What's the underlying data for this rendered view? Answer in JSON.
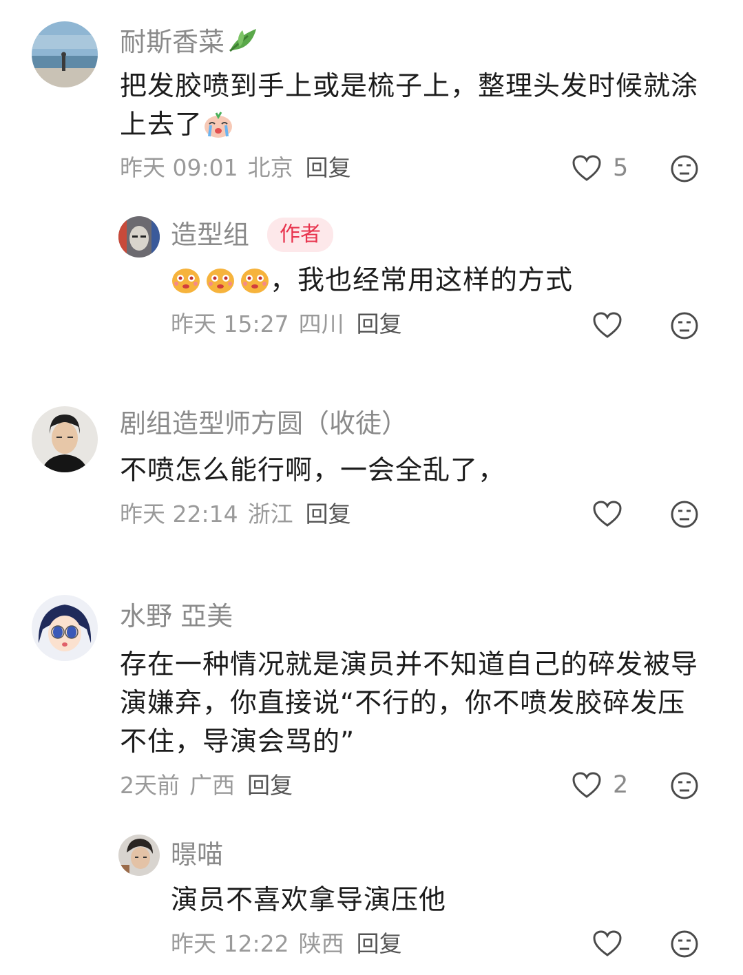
{
  "comments": [
    {
      "username": "耐斯香菜",
      "username_icon": "leaf-icon",
      "text": "把发胶喷到手上或是梳子上，整理头发时候就涂上去了",
      "trailing_emoji": "crying-emoji",
      "time": "昨天 09:01",
      "location": "北京",
      "reply_label": "回复",
      "likes": "5"
    },
    {
      "username": "造型组",
      "badge": "作者",
      "leading_emoji": "blushing-emoji",
      "text": "，我也经常用这样的方式",
      "time": "昨天 15:27",
      "location": "四川",
      "reply_label": "回复",
      "likes": ""
    },
    {
      "username": "剧组造型师方圆（收徒）",
      "text": "不喷怎么能行啊，一会全乱了，",
      "time": "昨天 22:14",
      "location": "浙江",
      "reply_label": "回复",
      "likes": ""
    },
    {
      "username": "水野 亞美",
      "text": "存在一种情况就是演员并不知道自己的碎发被导演嫌弃，你直接说“不行的，你不喷发胶碎发压不住，导演会骂的”",
      "time": "2天前",
      "location": "广西",
      "reply_label": "回复",
      "likes": "2"
    },
    {
      "username": "暻喵",
      "text": "演员不喜欢拿导演压他",
      "time": "昨天 12:22",
      "location": "陕西",
      "reply_label": "回复",
      "likes": ""
    }
  ],
  "icons": {
    "like": "heart-outline-icon",
    "dislike": "meh-face-icon"
  },
  "colors": {
    "username": "#8a8a8a",
    "badge_bg": "#fde8ea",
    "badge_text": "#e8344e",
    "meta": "#9a9a9a"
  }
}
